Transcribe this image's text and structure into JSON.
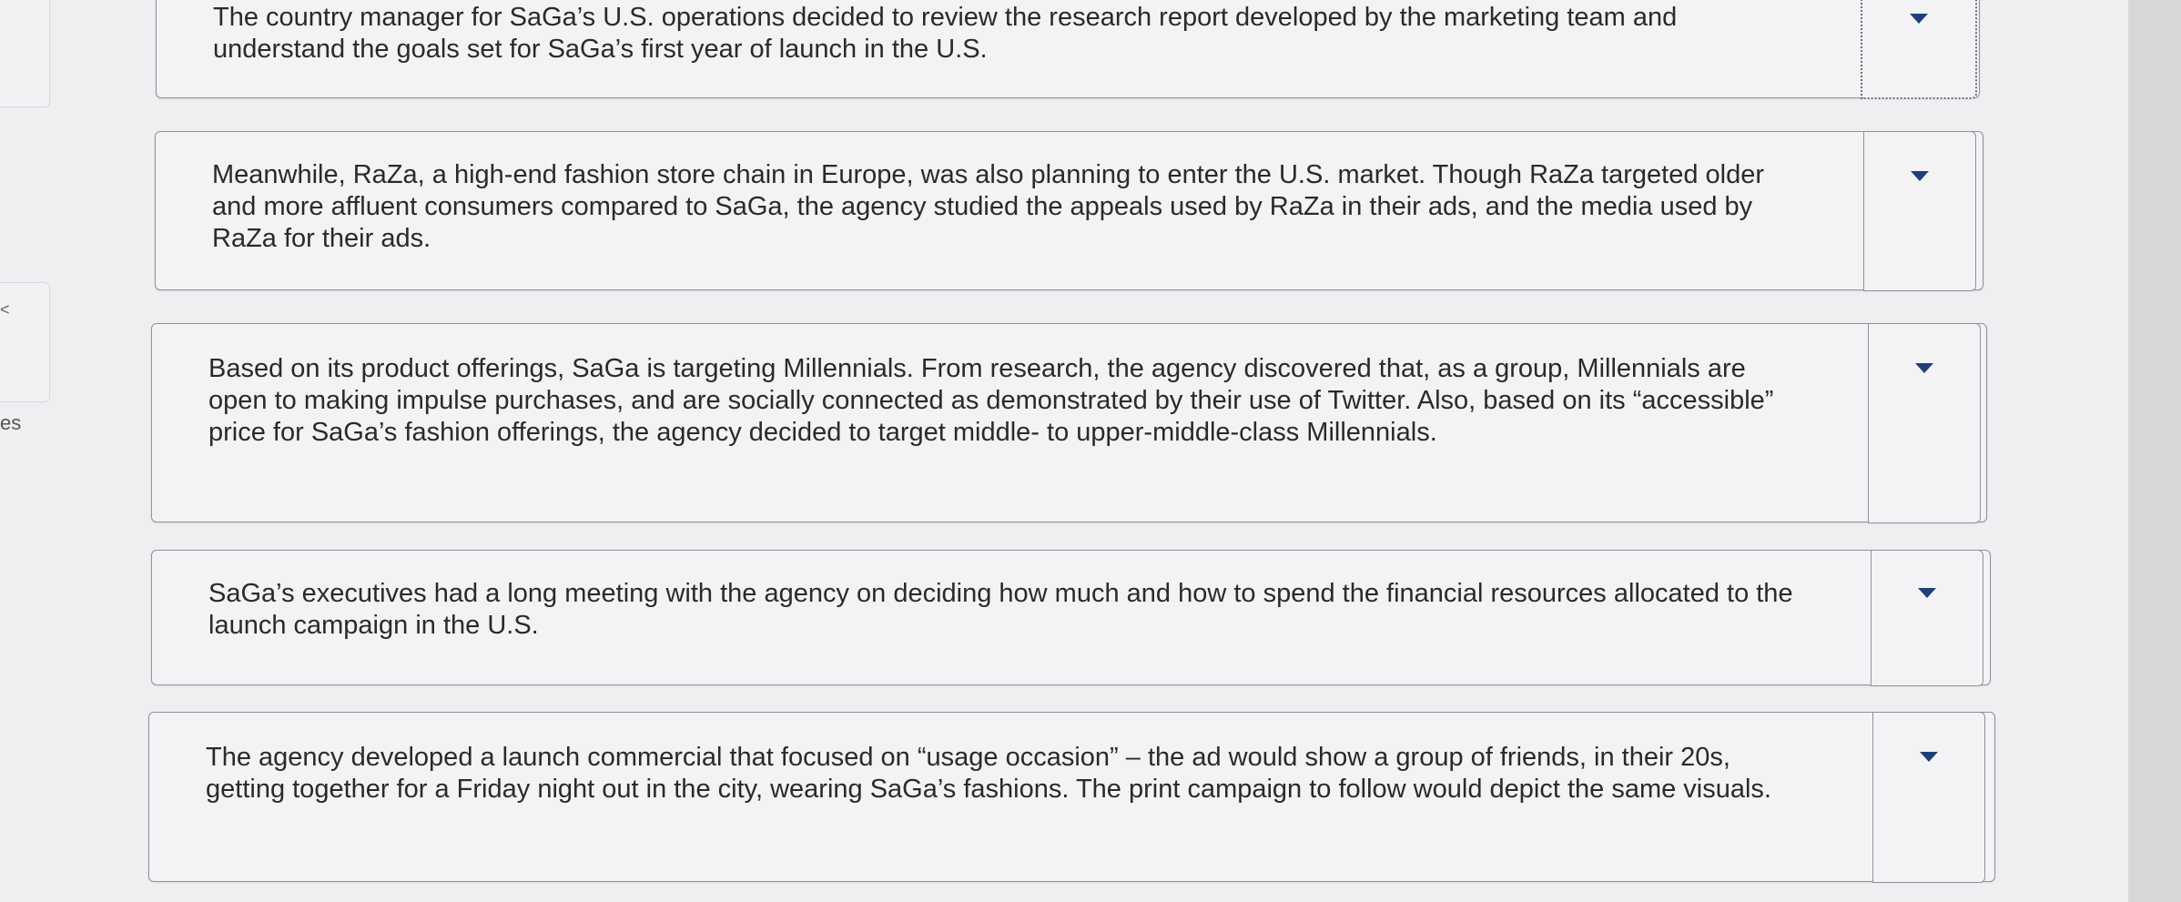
{
  "sidebar": {
    "label": "es",
    "caret": "<"
  },
  "items": [
    {
      "text": "The country manager for SaGa’s U.S. operations decided to review the research report developed by the marketing team and understand the goals set for SaGa’s first year of launch in the U.S."
    },
    {
      "text": "Meanwhile, RaZa, a high-end fashion store chain in Europe, was also planning to enter the U.S. market. Though RaZa targeted older and more affluent consumers compared to SaGa, the agency studied the appeals used by RaZa in their ads, and the media used by RaZa for their ads."
    },
    {
      "text": "Based on its product offerings, SaGa is targeting Millennials. From research, the agency discovered that, as a group, Millennials are open to making impulse purchases, and are socially connected as demonstrated by their use of Twitter. Also, based on its “accessible” price for SaGa’s fashion offerings, the agency decided to target middle- to upper-middle-class Millennials."
    },
    {
      "text": "SaGa’s executives had a long meeting with the agency on deciding how much and how to spend the financial resources allocated to the launch campaign in the U.S."
    },
    {
      "text": "The agency developed a launch commercial that focused on “usage occasion” – the ad would show a group of friends, in their 20s, getting together for a Friday night out in the city, wearing SaGa’s fashions. The print campaign to follow would depict the same visuals."
    }
  ]
}
